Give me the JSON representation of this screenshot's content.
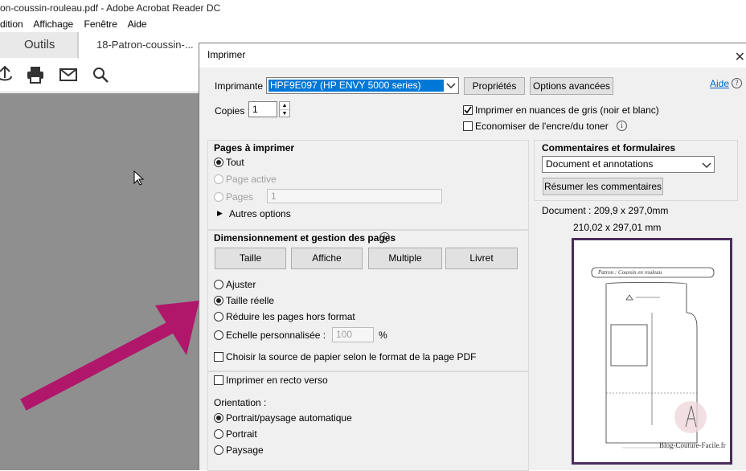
{
  "app": {
    "title": "on-coussin-rouleau.pdf - Adobe Acrobat Reader DC",
    "menu": [
      "dition",
      "Affichage",
      "Fenêtre",
      "Aide"
    ],
    "tab_tools": "Outils",
    "tab_doc": "18-Patron-coussin-..."
  },
  "dialog": {
    "title": "Imprimer",
    "printer_label": "Imprimante :",
    "printer_value": "HPF9E097 (HP ENVY 5000 series)",
    "properties_button": "Propriétés",
    "advanced_button": "Options avancées",
    "help_link": "Aide",
    "copies_label": "Copies :",
    "copies_value": "1",
    "grayscale_label": "Imprimer en nuances de gris (noir et blanc)",
    "grayscale_checked": true,
    "save_ink_label": "Economiser de l'encre/du toner",
    "save_ink_checked": false,
    "pages": {
      "heading": "Pages à imprimer",
      "all": "Tout",
      "current": "Page active",
      "pages": "Pages",
      "pages_value": "1",
      "more_options": "Autres options"
    },
    "sizing": {
      "heading": "Dimensionnement et gestion des pages",
      "buttons": [
        "Taille",
        "Affiche",
        "Multiple",
        "Livret"
      ],
      "fit": "Ajuster",
      "actual": "Taille réelle",
      "shrink": "Réduire les pages hors format",
      "custom": "Echelle personnalisée :",
      "custom_value": "100",
      "percent": "%",
      "paper_source": "Choisir la source de papier selon le format de la page PDF"
    },
    "duplex_label": "Imprimer en recto verso",
    "orientation": {
      "heading": "Orientation :",
      "auto": "Portrait/paysage automatique",
      "portrait": "Portrait",
      "landscape": "Paysage"
    },
    "comments": {
      "heading": "Commentaires et formulaires",
      "select_value": "Document et annotations",
      "summarize_button": "Résumer les commentaires"
    },
    "preview": {
      "doc_size": "Document : 209,9 x 297,0mm",
      "paper_size": "210,02 x 297,01 mm",
      "page_title": "Patron : Coussin en rouleau",
      "watermark": "Blog-Couture-Facile.fr"
    }
  },
  "colors": {
    "arrow": "#b0176b",
    "selection": "#0078d7",
    "preview_border": "#4a2d5a"
  }
}
